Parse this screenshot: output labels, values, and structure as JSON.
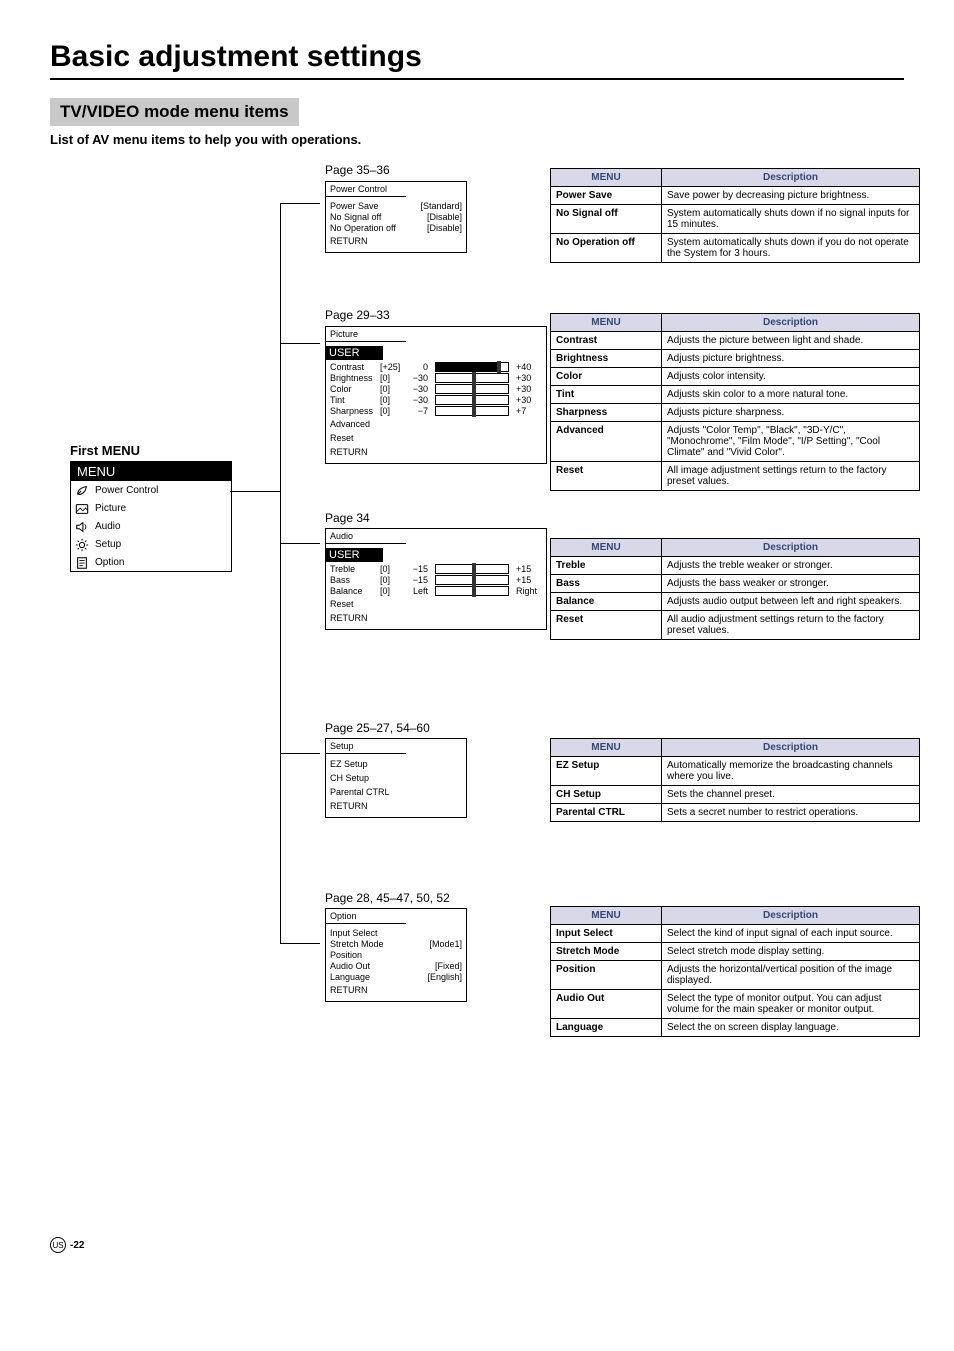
{
  "page": {
    "title": "Basic adjustment settings",
    "section_bar": "TV/VIDEO mode menu items",
    "subtitle": "List of AV menu items to help you with operations.",
    "footer_region": "US",
    "footer_page": "-22"
  },
  "first_menu": {
    "label": "First MENU",
    "header": "MENU",
    "items": [
      {
        "label": "Power Control",
        "icon": "leaf-icon"
      },
      {
        "label": "Picture",
        "icon": "picture-icon"
      },
      {
        "label": "Audio",
        "icon": "speaker-icon"
      },
      {
        "label": "Setup",
        "icon": "gear-icon"
      },
      {
        "label": "Option",
        "icon": "doc-icon"
      }
    ]
  },
  "page_labels": {
    "power": "Page 35–36",
    "picture": "Page 29–33",
    "audio": "Page 34",
    "setup": "Page 25–27, 54–60",
    "option": "Page 28, 45–47, 50, 52"
  },
  "osd": {
    "power": {
      "title": "Power Control",
      "rows": [
        {
          "label": "Power Save",
          "val": "[Standard]"
        },
        {
          "label": "No Signal off",
          "val": "[Disable]"
        },
        {
          "label": "No Operation off",
          "val": "[Disable]"
        }
      ],
      "return": "RETURN"
    },
    "picture": {
      "title": "Picture",
      "user": "USER",
      "rows": [
        {
          "label": "Contrast",
          "cur": "[+25]",
          "min": "0",
          "max": "+40",
          "pos": 85
        },
        {
          "label": "Brightness",
          "cur": "[0]",
          "min": "−30",
          "max": "+30",
          "pos": 50
        },
        {
          "label": "Color",
          "cur": "[0]",
          "min": "−30",
          "max": "+30",
          "pos": 50
        },
        {
          "label": "Tint",
          "cur": "[0]",
          "min": "−30",
          "max": "+30",
          "pos": 50
        },
        {
          "label": "Sharpness",
          "cur": "[0]",
          "min": "−7",
          "max": "+7",
          "pos": 50
        }
      ],
      "extra": [
        "Advanced",
        "Reset"
      ],
      "return": "RETURN"
    },
    "audio": {
      "title": "Audio",
      "user": "USER",
      "rows": [
        {
          "label": "Treble",
          "cur": "[0]",
          "min": "−15",
          "max": "+15",
          "pos": 50
        },
        {
          "label": "Bass",
          "cur": "[0]",
          "min": "−15",
          "max": "+15",
          "pos": 50
        },
        {
          "label": "Balance",
          "cur": "[0]",
          "min": "Left",
          "max": "Right",
          "pos": 50
        }
      ],
      "extra": [
        "Reset"
      ],
      "return": "RETURN"
    },
    "setup": {
      "title": "Setup",
      "rows": [
        {
          "label": "EZ Setup"
        },
        {
          "label": "CH Setup"
        },
        {
          "label": "Parental CTRL"
        }
      ],
      "return": "RETURN"
    },
    "option": {
      "title": "Option",
      "rows": [
        {
          "label": "Input Select",
          "val": ""
        },
        {
          "label": "Stretch Mode",
          "val": "[Mode1]"
        },
        {
          "label": "Position",
          "val": ""
        },
        {
          "label": "Audio Out",
          "val": "[Fixed]"
        },
        {
          "label": "Language",
          "val": "[English]"
        }
      ],
      "return": "RETURN"
    }
  },
  "tables": {
    "headers": {
      "menu": "MENU",
      "desc": "Description"
    },
    "power": [
      {
        "name": "Power Save",
        "desc": "Save power by decreasing picture brightness."
      },
      {
        "name": "No Signal off",
        "desc": "System automatically shuts down if no signal inputs for 15 minutes."
      },
      {
        "name": "No Operation off",
        "desc": "System automatically shuts down if you do not operate the System for 3 hours."
      }
    ],
    "picture": [
      {
        "name": "Contrast",
        "desc": "Adjusts the picture between light and shade."
      },
      {
        "name": "Brightness",
        "desc": "Adjusts picture brightness."
      },
      {
        "name": "Color",
        "desc": "Adjusts color intensity."
      },
      {
        "name": "Tint",
        "desc": "Adjusts skin color to a more natural tone."
      },
      {
        "name": "Sharpness",
        "desc": "Adjusts picture sharpness."
      },
      {
        "name": "Advanced",
        "desc": "Adjusts \"Color Temp\", \"Black\", \"3D-Y/C\", \"Monochrome\", \"Film Mode\", \"I/P Setting\", \"Cool Climate\" and \"Vivid Color\"."
      },
      {
        "name": "Reset",
        "desc": "All image adjustment settings return to the factory preset values."
      }
    ],
    "audio": [
      {
        "name": "Treble",
        "desc": "Adjusts the treble weaker or stronger."
      },
      {
        "name": "Bass",
        "desc": "Adjusts the bass weaker or stronger."
      },
      {
        "name": "Balance",
        "desc": "Adjusts audio output between left and right speakers."
      },
      {
        "name": "Reset",
        "desc": "All audio adjustment settings return to the factory preset values."
      }
    ],
    "setup": [
      {
        "name": "EZ Setup",
        "desc": "Automatically memorize the broadcasting channels where you live."
      },
      {
        "name": "CH Setup",
        "desc": "Sets the channel preset."
      },
      {
        "name": "Parental CTRL",
        "desc": "Sets a secret number to restrict operations."
      }
    ],
    "option": [
      {
        "name": "Input Select",
        "desc": "Select the kind of input signal of each input source."
      },
      {
        "name": "Stretch Mode",
        "desc": "Select stretch mode display setting."
      },
      {
        "name": "Position",
        "desc": "Adjusts the horizontal/vertical position of the image displayed."
      },
      {
        "name": "Audio Out",
        "desc": "Select the type of monitor output. You can adjust volume for the main speaker or monitor output."
      },
      {
        "name": "Language",
        "desc": "Select the on screen display language."
      }
    ]
  }
}
